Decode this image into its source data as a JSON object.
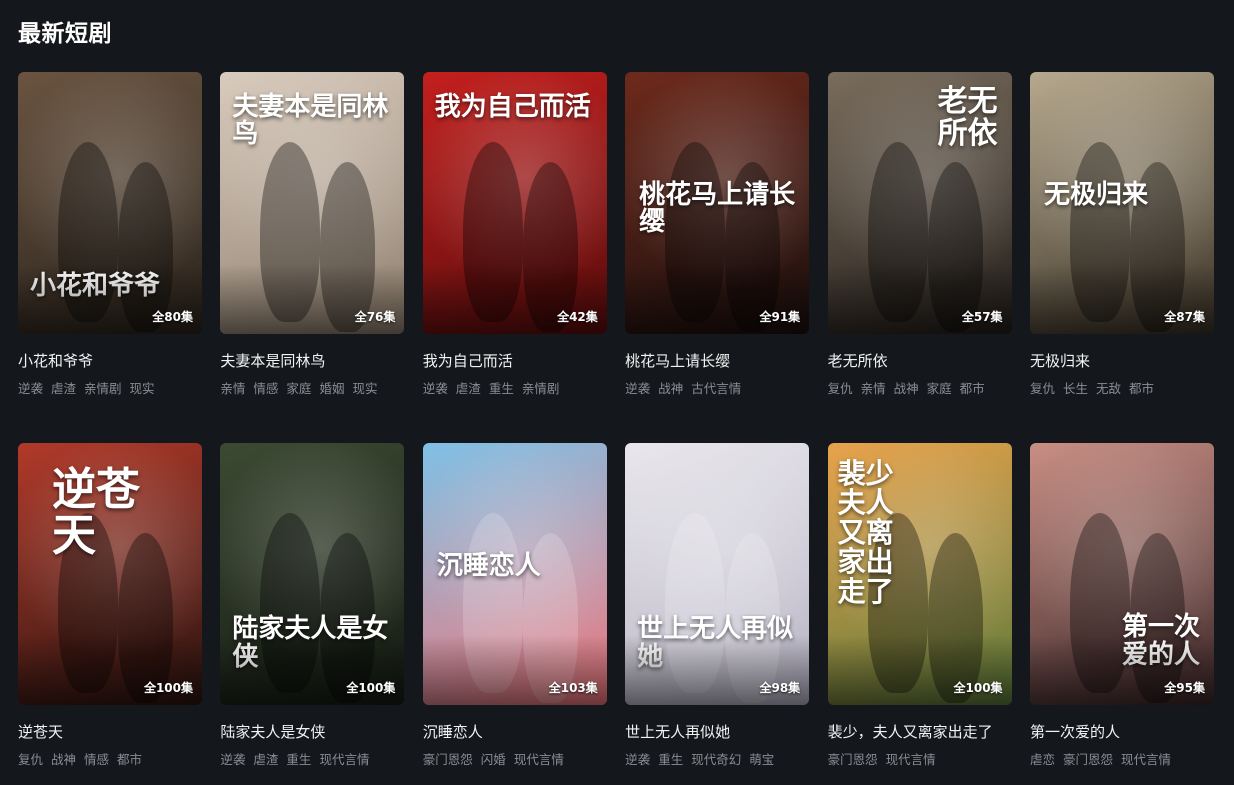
{
  "section": {
    "title": "最新短剧"
  },
  "dramas": [
    {
      "title": "小花和爷爷",
      "episodes": "全80集",
      "tags": [
        "逆袭",
        "虐渣",
        "亲情剧",
        "现实"
      ],
      "poster_text": "小花和爷爷",
      "colors": [
        "#6a5440",
        "#2a231c"
      ],
      "art_style": "bottom"
    },
    {
      "title": "夫妻本是同林鸟",
      "episodes": "全76集",
      "tags": [
        "亲情",
        "情感",
        "家庭",
        "婚姻",
        "现实"
      ],
      "poster_text": "夫妻本是同林鸟",
      "colors": [
        "#d9cbbd",
        "#8f7f6e"
      ],
      "art_style": "top"
    },
    {
      "title": "我为自己而活",
      "episodes": "全42集",
      "tags": [
        "逆袭",
        "虐渣",
        "重生",
        "亲情剧"
      ],
      "poster_text": "我为自己而活",
      "colors": [
        "#c4201e",
        "#5a0c0c"
      ],
      "art_style": "top"
    },
    {
      "title": "桃花马上请长缨",
      "episodes": "全91集",
      "tags": [
        "逆袭",
        "战神",
        "古代言情"
      ],
      "poster_text": "桃花马上请长缨",
      "colors": [
        "#6e2a1c",
        "#1a0f0d"
      ],
      "art_style": "middle"
    },
    {
      "title": "老无所依",
      "episodes": "全57集",
      "tags": [
        "复仇",
        "亲情",
        "战神",
        "家庭",
        "都市"
      ],
      "poster_text": "老无所依",
      "colors": [
        "#7a6d5d",
        "#231e1a"
      ],
      "art_style": "topright"
    },
    {
      "title": "无极归来",
      "episodes": "全87集",
      "tags": [
        "复仇",
        "长生",
        "无敌",
        "都市"
      ],
      "poster_text": "无极归来",
      "colors": [
        "#b7a98e",
        "#3a3226"
      ],
      "art_style": "middle"
    },
    {
      "title": "逆苍天",
      "episodes": "全100集",
      "tags": [
        "复仇",
        "战神",
        "情感",
        "都市"
      ],
      "poster_text": "逆苍天",
      "colors": [
        "#b23a2a",
        "#2a1410"
      ],
      "art_style": "topbig"
    },
    {
      "title": "陆家夫人是女侠",
      "episodes": "全100集",
      "tags": [
        "逆袭",
        "虐渣",
        "重生",
        "现代言情"
      ],
      "poster_text": "陆家夫人是女侠",
      "colors": [
        "#3c4a33",
        "#141a12"
      ],
      "art_style": "bottom"
    },
    {
      "title": "沉睡恋人",
      "episodes": "全103集",
      "tags": [
        "豪门恩怨",
        "闪婚",
        "现代言情"
      ],
      "poster_text": "沉睡恋人",
      "colors": [
        "#7fc1e6",
        "#f0767b"
      ],
      "art_style": "middle"
    },
    {
      "title": "世上无人再似她",
      "episodes": "全98集",
      "tags": [
        "逆袭",
        "重生",
        "现代奇幻",
        "萌宝"
      ],
      "poster_text": "世上无人再似她",
      "colors": [
        "#e9e7ec",
        "#b7b3c4"
      ],
      "art_style": "bottom"
    },
    {
      "title": "裴少，夫人又离家出走了",
      "episodes": "全100集",
      "tags": [
        "豪门恩怨",
        "现代言情"
      ],
      "poster_text": "裴少夫人又离家出走了",
      "colors": [
        "#e8a34c",
        "#5d7a3a"
      ],
      "art_style": "left"
    },
    {
      "title": "第一次爱的人",
      "episodes": "全95集",
      "tags": [
        "虐恋",
        "豪门恩怨",
        "现代言情"
      ],
      "poster_text": "第一次爱的人",
      "colors": [
        "#c98f84",
        "#3b2628"
      ],
      "art_style": "bottomright"
    }
  ]
}
